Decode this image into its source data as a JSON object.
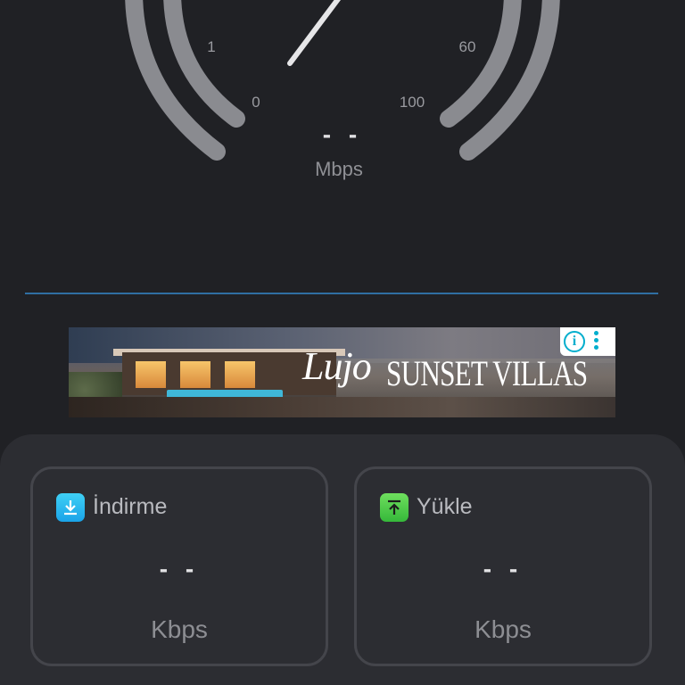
{
  "gauge": {
    "ticks": [
      "1",
      "60",
      "0",
      "100"
    ],
    "value": "- -",
    "unit": "Mbps"
  },
  "ad": {
    "brand": "Lujo",
    "headline": "SUNSET VILLAS",
    "info_icon": "i"
  },
  "cards": {
    "download": {
      "icon": "download-icon",
      "title": "İndirme",
      "value": "- -",
      "unit": "Kbps"
    },
    "upload": {
      "icon": "upload-icon",
      "title": "Yükle",
      "value": "- -",
      "unit": "Kbps"
    }
  },
  "colors": {
    "background": "#202125",
    "panel": "#2c2d32",
    "divider": "#2f6fa3",
    "download_accent": "#1aa3e8",
    "upload_accent": "#35b83a",
    "ad_choices": "#00aecd"
  }
}
